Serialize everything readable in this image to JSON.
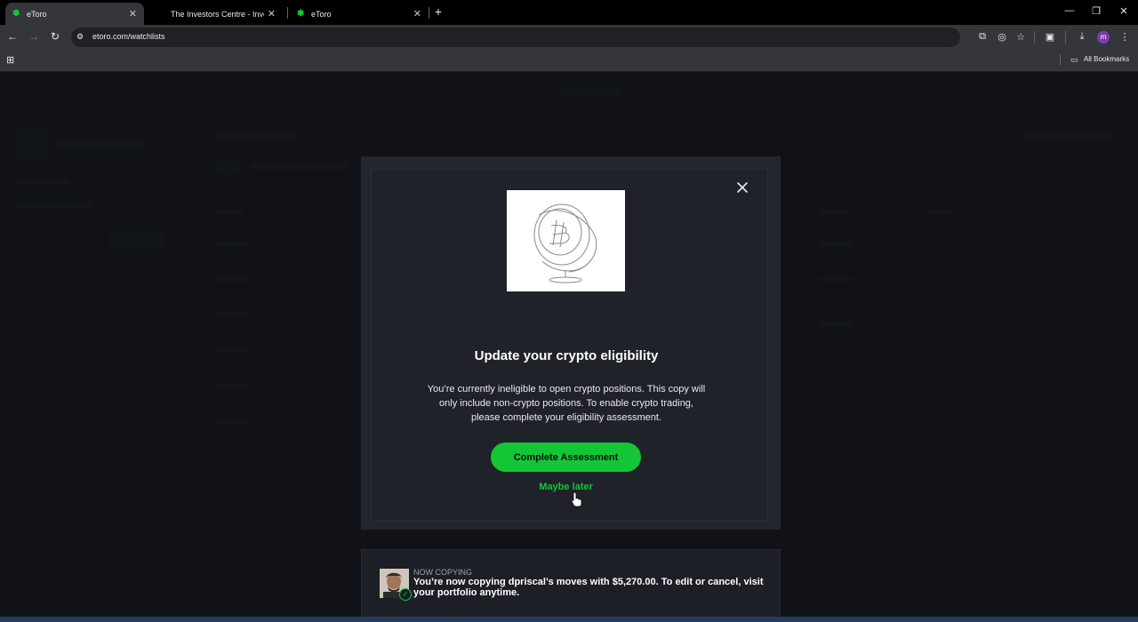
{
  "browser": {
    "tabs": [
      {
        "label": "eToro",
        "active": true
      },
      {
        "label": "The Investors Centre - Investing",
        "active": false
      },
      {
        "label": "eToro",
        "active": false
      }
    ],
    "new_tab_icon": "plus-icon",
    "url": "etoro.com/watchlists",
    "bookmarks_label": "All Bookmarks",
    "profile_initial": "m"
  },
  "modal": {
    "title": "Update your crypto eligibility",
    "body": "You’re currently ineligible to open crypto positions. This copy will only include non-crypto positions. To enable crypto trading, please complete your eligibility assessment.",
    "primary_button": "Complete Assessment",
    "secondary_link": "Maybe later"
  },
  "toast": {
    "kicker": "NOW COPYING",
    "message": "You’re now copying dpriscal’s moves with $5,270.00. To edit or cancel, visit your portfolio anytime."
  },
  "colors": {
    "accent": "#13c636",
    "modal_bg": "#1f2228",
    "page_bg": "#1b1d24"
  }
}
